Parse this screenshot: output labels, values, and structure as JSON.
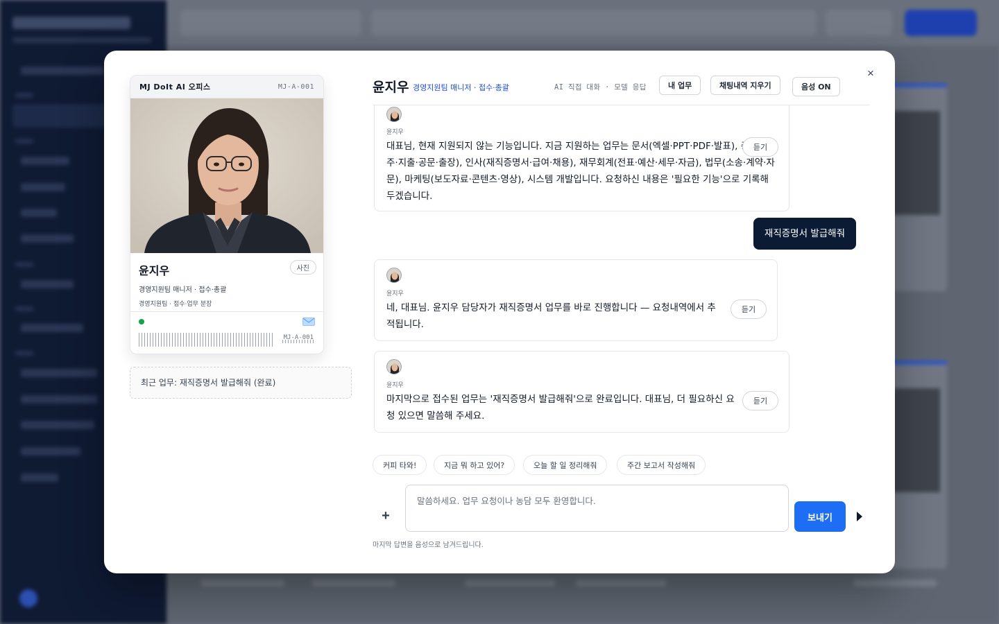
{
  "modal": {
    "close_label": "×",
    "id_card": {
      "brand": "MJ DoIt AI 오피스",
      "code": "MJ-A-001",
      "name": "윤지우",
      "role": "경영지원팀 매니저 · 접수·총괄",
      "dept": "경영지원팀 · 접수·업무 분장",
      "photo_button": "사진",
      "barcode_code": "MJ-A-001",
      "status_color": "#16a34a"
    },
    "recent_task": "최근 업무: 재직증명서 발급해줘 (완료)",
    "chat": {
      "name": "윤지우",
      "role": "경영지원팀 매니저 · 접수·총괄",
      "mode": "AI 직접 대화 · 모델 응답",
      "buttons": {
        "my_tasks": "내 업무",
        "clear_history": "채팅내역 지우기",
        "voice": "음성 ON"
      },
      "messages": [
        {
          "role": "assistant",
          "sender": "윤지우",
          "text": "대표님, 현재 지원되지 않는 기능입니다. 지금 지원하는 업무는 문서(엑셀·PPT·PDF·발표), 총무(발주·지출·공문·출장), 인사(재직증명서·급여·채용), 재무회계(전표·예산·세무·자금), 법무(소송·계약·자문), 마케팅(보도자료·콘텐츠·영상), 시스템 개발입니다. 요청하신 내용은 '필요한 기능'으로 기록해 두겠습니다.",
          "listen": "듣기"
        },
        {
          "role": "user",
          "text": "재직증명서 발급해줘"
        },
        {
          "role": "assistant",
          "sender": "윤지우",
          "text": "네, 대표님. 윤지우 담당자가 재직증명서 업무를 바로 진행합니다 — 요청내역에서 추적됩니다.",
          "listen": "듣기"
        },
        {
          "role": "assistant",
          "sender": "윤지우",
          "text": "마지막으로 접수된 업무는 '재직증명서 발급해줘'으로 완료입니다. 대표님, 더 필요하신 요청 있으면 말씀해 주세요.",
          "listen": "듣기"
        }
      ],
      "suggestions": [
        "커피 타와!",
        "지금 뭐 하고 있어?",
        "오늘 할 일 정리해줘",
        "주간 보고서 작성해줘"
      ],
      "input_placeholder": "말씀하세요. 업무 요청이나 농담 모두 환영합니다.",
      "input_value": "",
      "plus_label": "+",
      "send_label": "보내기",
      "footnote": "마지막 답변을 음성으로 남겨드립니다."
    },
    "colors": {
      "accent": "#1d6ef5",
      "role_text": "#1d4ed8",
      "user_bubble": "#0b1b33"
    }
  }
}
